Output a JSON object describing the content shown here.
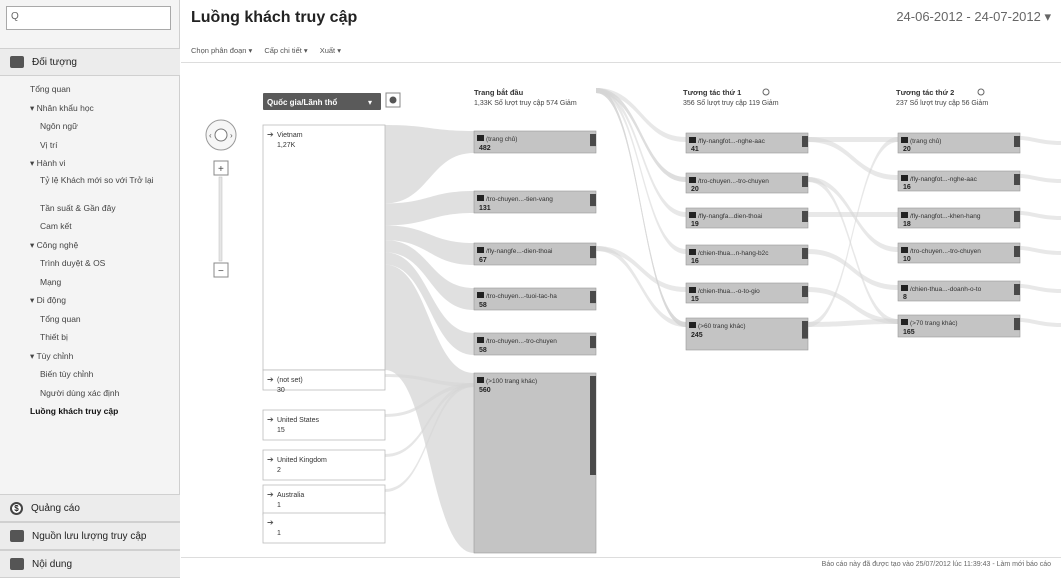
{
  "search": {
    "placeholder": "Q"
  },
  "sidebar": {
    "sections": [
      {
        "label": "Đối tượng",
        "icon": "audience-icon"
      },
      {
        "label": "Quảng cáo",
        "icon": "advertising-icon"
      },
      {
        "label": "Nguồn lưu lượng truy cập",
        "icon": "traffic-sources-icon"
      },
      {
        "label": "Nội dung",
        "icon": "content-icon"
      }
    ],
    "items": [
      {
        "label": "Tổng quan",
        "level": 1
      },
      {
        "label": "▾ Nhân khẩu học",
        "level": 1
      },
      {
        "label": "Ngôn ngữ",
        "level": 2
      },
      {
        "label": "Vị trí",
        "level": 2
      },
      {
        "label": "▾ Hành vi",
        "level": 1
      },
      {
        "label": "Tỷ lệ Khách mới so với Trở lại",
        "level": 2
      },
      {
        "label": "Tần suất & Gần đây",
        "level": 2
      },
      {
        "label": "Cam kết",
        "level": 2
      },
      {
        "label": "▾ Công nghệ",
        "level": 1
      },
      {
        "label": "Trình duyệt & OS",
        "level": 2
      },
      {
        "label": "Mạng",
        "level": 2
      },
      {
        "label": "▾ Di động",
        "level": 1
      },
      {
        "label": "Tổng quan",
        "level": 2
      },
      {
        "label": "Thiết bị",
        "level": 2
      },
      {
        "label": "▾ Tùy chỉnh",
        "level": 1
      },
      {
        "label": "Biến tùy chỉnh",
        "level": 2
      },
      {
        "label": "Người dùng xác định",
        "level": 2
      },
      {
        "label": "Luồng khách truy cập",
        "level": 1
      }
    ]
  },
  "header": {
    "title": "Luồng khách truy cập",
    "date_range": "24-06-2012 - 24-07-2012 ▾"
  },
  "toolbar": {
    "segment": "Chọn phân đoạn ▾",
    "detail": "Cấp chi tiết ▾",
    "export": "Xuất ▾"
  },
  "flow": {
    "dimension_selector": "Quốc gia/Lãnh thổ",
    "countries": [
      {
        "name": "Vietnam",
        "value": "1,27K"
      },
      {
        "name": "(not set)",
        "value": "30"
      },
      {
        "name": "United States",
        "value": "15"
      },
      {
        "name": "United Kingdom",
        "value": "2"
      },
      {
        "name": "Australia",
        "value": "1"
      },
      {
        "name": "",
        "value": "1"
      }
    ],
    "columns": [
      {
        "title": "Trang bắt đầu",
        "subtitle": "1,33K Số lượt truy cập 574 Giảm",
        "nodes": [
          {
            "label": "(trang chủ)",
            "value": "482"
          },
          {
            "label": "/tro-chuyen...-tien-vang",
            "value": "131"
          },
          {
            "label": "/fly-nangfe...-dien-thoai",
            "value": "67"
          },
          {
            "label": "/tro-chuyen...-tuoi-tac-ha",
            "value": "58"
          },
          {
            "label": "/tro-chuyen...-tro-chuyen",
            "value": "58"
          },
          {
            "label": "(>100 trang khác)",
            "value": "560"
          }
        ]
      },
      {
        "title": "Tương tác thứ 1",
        "subtitle": "356 Số lượt truy cập 119 Giảm",
        "nodes": [
          {
            "label": "/fly-nangfot...-nghe-aac",
            "value": "41"
          },
          {
            "label": "/tro-chuyen...-tro-chuyen",
            "value": "20"
          },
          {
            "label": "/fly-nangfa...dien-thoai",
            "value": "19"
          },
          {
            "label": "/chien-thua...n-hang-b2c",
            "value": "16"
          },
          {
            "label": "/chien-thua...-o-to-gio",
            "value": "15"
          },
          {
            "label": "(>60 trang khác)",
            "value": "245"
          }
        ]
      },
      {
        "title": "Tương tác thứ 2",
        "subtitle": "237 Số lượt truy cập 56 Giảm",
        "nodes": [
          {
            "label": "(trang chủ)",
            "value": "20"
          },
          {
            "label": "/fly-nangfot...-nghe-aac",
            "value": "16"
          },
          {
            "label": "/fly-nangfot...-khen-hang",
            "value": "18"
          },
          {
            "label": "/tro-chuyen...-tro-chuyen",
            "value": "10"
          },
          {
            "label": "/chien-thua...-doanh-o-to",
            "value": "8"
          },
          {
            "label": "(>70 trang khác)",
            "value": "165"
          }
        ]
      }
    ]
  },
  "footer": {
    "note": "Báo cáo này đã được tạo vào 25/07/2012 lúc 11:39:43 - Làm mới báo cáo"
  },
  "colors": {
    "node_fill": "#c4c4c4",
    "flow_fill": "#d6d6d6",
    "drop_fill": "#4a4a4a",
    "selector_bg": "#5a5a5a"
  }
}
